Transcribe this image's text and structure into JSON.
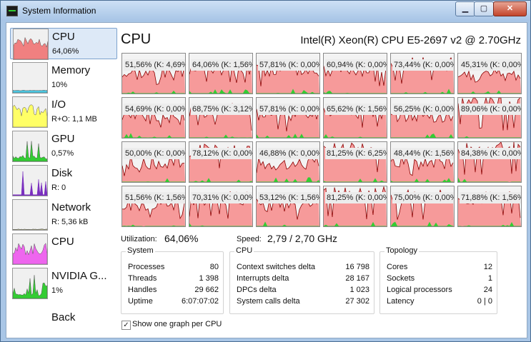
{
  "window": {
    "title": "System Information",
    "minimize": "▁",
    "maximize": "▢",
    "close": "✕"
  },
  "sidebar": {
    "items": [
      {
        "label": "CPU",
        "sub": "64,06%",
        "selected": true,
        "color": "#f08080",
        "icon": "cpu-graph-icon"
      },
      {
        "label": "Memory",
        "sub": "10%",
        "selected": false,
        "color": "#4cc6e0",
        "icon": "memory-graph-icon"
      },
      {
        "label": "I/O",
        "sub": "R+O: 1,1 MB",
        "selected": false,
        "color": "#ffff66",
        "icon": "io-graph-icon"
      },
      {
        "label": "GPU",
        "sub": "0,57%",
        "selected": false,
        "color": "#33cc33",
        "icon": "gpu-graph-icon"
      },
      {
        "label": "Disk",
        "sub": "R: 0",
        "selected": false,
        "color": "#7a2fbf",
        "icon": "disk-graph-icon"
      },
      {
        "label": "Network",
        "sub": "R: 5,36 kB",
        "selected": false,
        "color": "#bdbd8a",
        "icon": "network-graph-icon"
      },
      {
        "label": "CPU",
        "sub": "",
        "selected": false,
        "color": "#ee66ee",
        "icon": "cpu-graph-icon"
      },
      {
        "label": "NVIDIA G...",
        "sub": "1%",
        "selected": false,
        "color": "#33cc33",
        "icon": "gpu-graph-icon"
      }
    ],
    "back": "Back"
  },
  "main": {
    "title": "CPU",
    "processor": "Intel(R) Xeon(R) CPU E5-2697 v2 @ 2.70GHz",
    "cores": [
      "51,56% (K: 4,69%)",
      "64,06% (K: 1,56%)",
      "57,81% (K: 0,00%)",
      "60,94% (K: 0,00%)",
      "73,44% (K: 0,00%)",
      "45,31% (K: 0,00%)",
      "54,69% (K: 0,00%)",
      "68,75% (K: 3,12%)",
      "57,81% (K: 0,00%)",
      "65,62% (K: 1,56%)",
      "56,25% (K: 0,00%)",
      "89,06% (K: 0,00%)",
      "50,00% (K: 0,00%)",
      "78,12% (K: 0,00%)",
      "46,88% (K: 0,00%)",
      "81,25% (K: 6,25%)",
      "48,44% (K: 1,56%)",
      "84,38% (K: 0,00%)",
      "51,56% (K: 1,56%)",
      "70,31% (K: 0,00%)",
      "53,12% (K: 1,56%)",
      "81,25% (K: 0,00%)",
      "75,00% (K: 0,00%)",
      "71,88% (K: 1,56%)"
    ],
    "utilization_label": "Utilization:",
    "utilization": "64,06%",
    "speed_label": "Speed:",
    "speed": "2,79 / 2,70 GHz",
    "colors": {
      "usage_fill": "#f69a9a",
      "usage_line": "#8b0000",
      "kernel": "#33cc33"
    }
  },
  "system": {
    "title": "System",
    "rows": [
      {
        "k": "Processes",
        "v": "80"
      },
      {
        "k": "Threads",
        "v": "1 398"
      },
      {
        "k": "Handles",
        "v": "29 662"
      },
      {
        "k": "Uptime",
        "v": "6:07:07:02"
      }
    ]
  },
  "cpu": {
    "title": "CPU",
    "rows": [
      {
        "k": "Context switches delta",
        "v": "16 798"
      },
      {
        "k": "Interrupts delta",
        "v": "28 167"
      },
      {
        "k": "DPCs delta",
        "v": "1 023"
      },
      {
        "k": "System calls delta",
        "v": "27 302"
      }
    ]
  },
  "topology": {
    "title": "Topology",
    "rows": [
      {
        "k": "Cores",
        "v": "12"
      },
      {
        "k": "Sockets",
        "v": "1"
      },
      {
        "k": "Logical processors",
        "v": "24"
      },
      {
        "k": "Latency",
        "v": "0 | 0"
      }
    ]
  },
  "options": {
    "one_graph_per_cpu_label": "Show one graph per CPU",
    "one_graph_per_cpu": true,
    "check": "✓"
  }
}
